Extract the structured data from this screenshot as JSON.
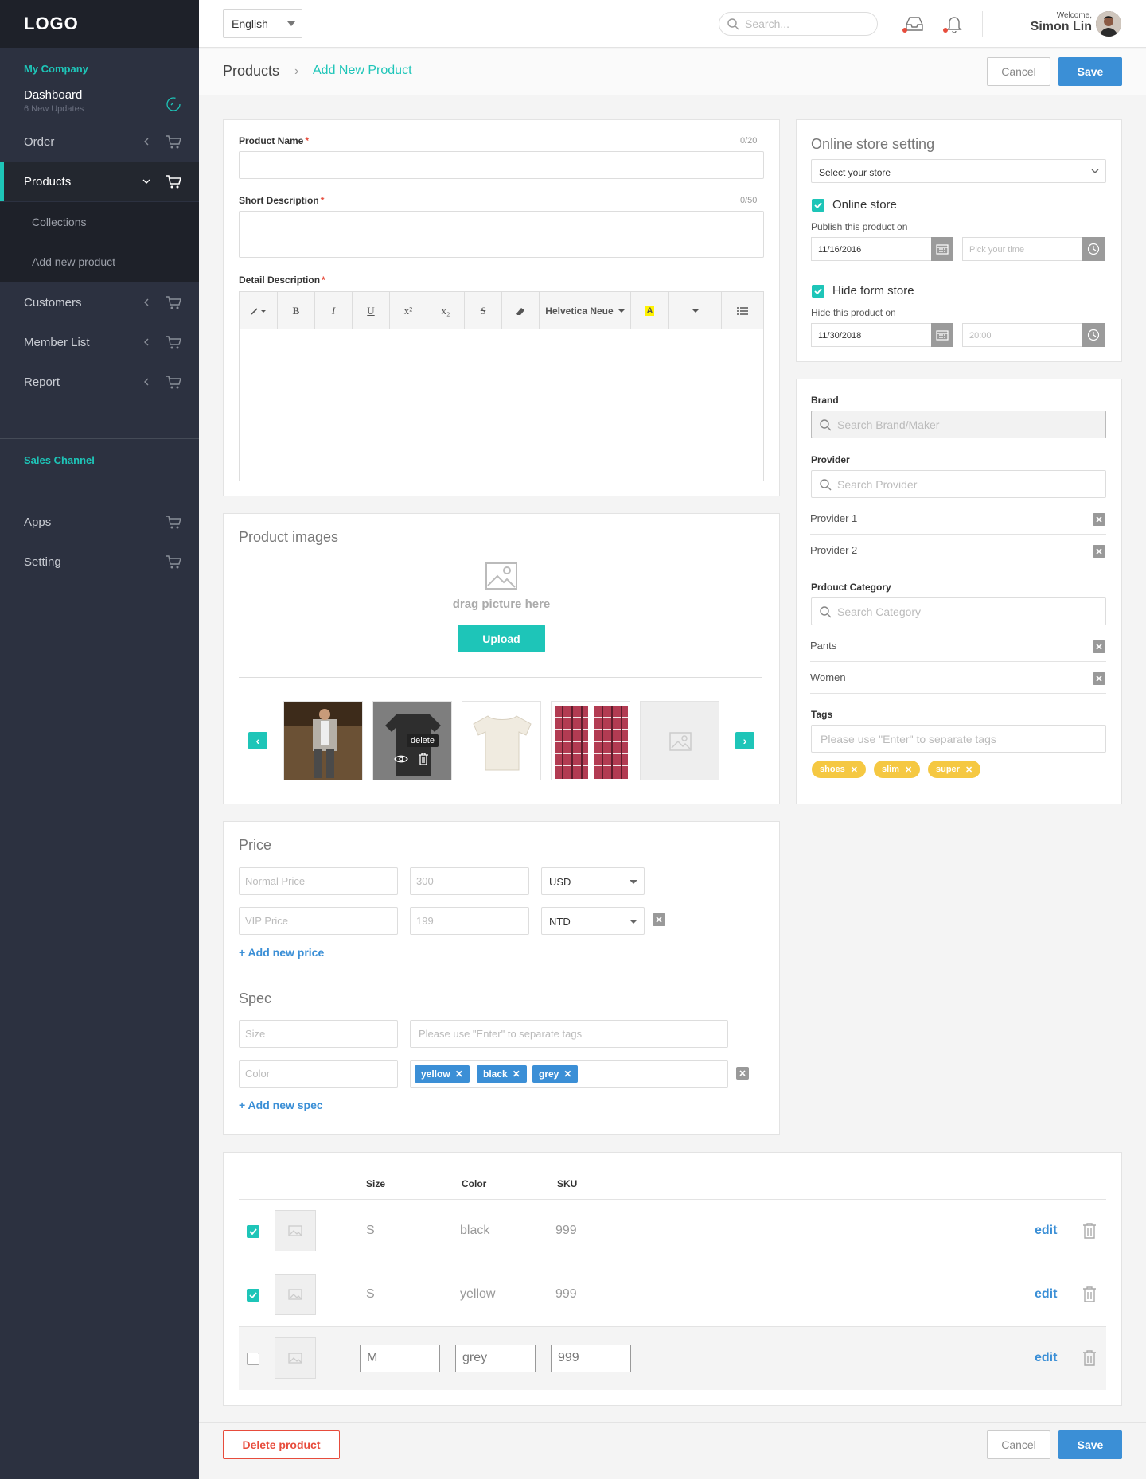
{
  "sidebar": {
    "logo": "LOGO",
    "section_company": "My Company",
    "dashboard": {
      "label": "Dashboard",
      "sub": "6 New Updates"
    },
    "items": [
      {
        "label": "Order"
      },
      {
        "label": "Products"
      },
      {
        "label": "Customers"
      },
      {
        "label": "Member List"
      },
      {
        "label": "Report"
      }
    ],
    "sub_items": [
      {
        "label": "Collections"
      },
      {
        "label": "Add new product"
      }
    ],
    "section_sales": "Sales Channel",
    "bottom_items": [
      {
        "label": "Apps"
      },
      {
        "label": "Setting"
      }
    ]
  },
  "topbar": {
    "language": "English",
    "search_placeholder": "Search...",
    "welcome": "Welcome,",
    "user_name": "Simon Lin"
  },
  "header": {
    "breadcrumb_root": "Products",
    "breadcrumb_separator": "›",
    "breadcrumb_current": "Add New Product",
    "cancel": "Cancel",
    "save": "Save"
  },
  "product_form": {
    "name_label": "Product Name",
    "name_count": "0/20",
    "short_label": "Short Description",
    "short_count": "0/50",
    "detail_label": "Detail Description",
    "required_mark": "*",
    "toolbar": {
      "bold": "B",
      "italic": "I",
      "underline": "U",
      "sup": "x²",
      "sub": "x₂",
      "strike": "S",
      "font": "Helvetica Neue",
      "color": "A"
    }
  },
  "images": {
    "title": "Product images",
    "drag_text": "drag picture here",
    "upload": "Upload",
    "delete_tooltip": "delete",
    "prev": "‹",
    "next": "›"
  },
  "price": {
    "title": "Price",
    "rows": [
      {
        "name_placeholder": "Normal Price",
        "value_placeholder": "300",
        "currency": "USD"
      },
      {
        "name_placeholder": "VIP Price",
        "value_placeholder": "199",
        "currency": "NTD"
      }
    ],
    "add": "+ Add new price"
  },
  "spec": {
    "title": "Spec",
    "size_placeholder": "Size",
    "tags_placeholder": "Please use \"Enter\" to separate tags",
    "color_placeholder": "Color",
    "color_tags": [
      "yellow",
      "black",
      "grey"
    ],
    "add": "+ Add new spec"
  },
  "store": {
    "title": "Online store setting",
    "select_placeholder": "Select your store",
    "online": {
      "label": "Online store",
      "sub": "Publish this product on",
      "date": "11/16/2016",
      "time_placeholder": "Pick your time"
    },
    "hide": {
      "label": "Hide form store",
      "sub": "Hide this product on",
      "date": "11/30/2018",
      "time_placeholder": "20:00"
    }
  },
  "meta": {
    "brand_label": "Brand",
    "brand_placeholder": "Search Brand/Maker",
    "provider_label": "Provider",
    "provider_placeholder": "Search Provider",
    "providers": [
      "Provider 1",
      "Provider 2"
    ],
    "category_label": "Prdouct Category",
    "category_placeholder": "Search Category",
    "categories": [
      "Pants",
      "Women"
    ],
    "tags_label": "Tags",
    "tags_placeholder": "Please use \"Enter\" to separate tags",
    "tags": [
      "shoes",
      "slim",
      "super"
    ]
  },
  "variants": {
    "headers": {
      "size": "Size",
      "color": "Color",
      "sku": "SKU"
    },
    "rows": [
      {
        "size": "S",
        "color": "black",
        "sku": "999",
        "checked": true
      },
      {
        "size": "S",
        "color": "yellow",
        "sku": "999",
        "checked": true
      },
      {
        "size": "M",
        "color": "grey",
        "sku": "999",
        "checked": false
      }
    ],
    "edit": "edit"
  },
  "footer": {
    "delete": "Delete product",
    "cancel": "Cancel",
    "save": "Save"
  },
  "colors": {
    "accent": "#1ec5b8",
    "primary": "#3b8fd6",
    "sidebar": "#2c3140",
    "danger": "#e74c3c",
    "tag": "#f5c842"
  }
}
